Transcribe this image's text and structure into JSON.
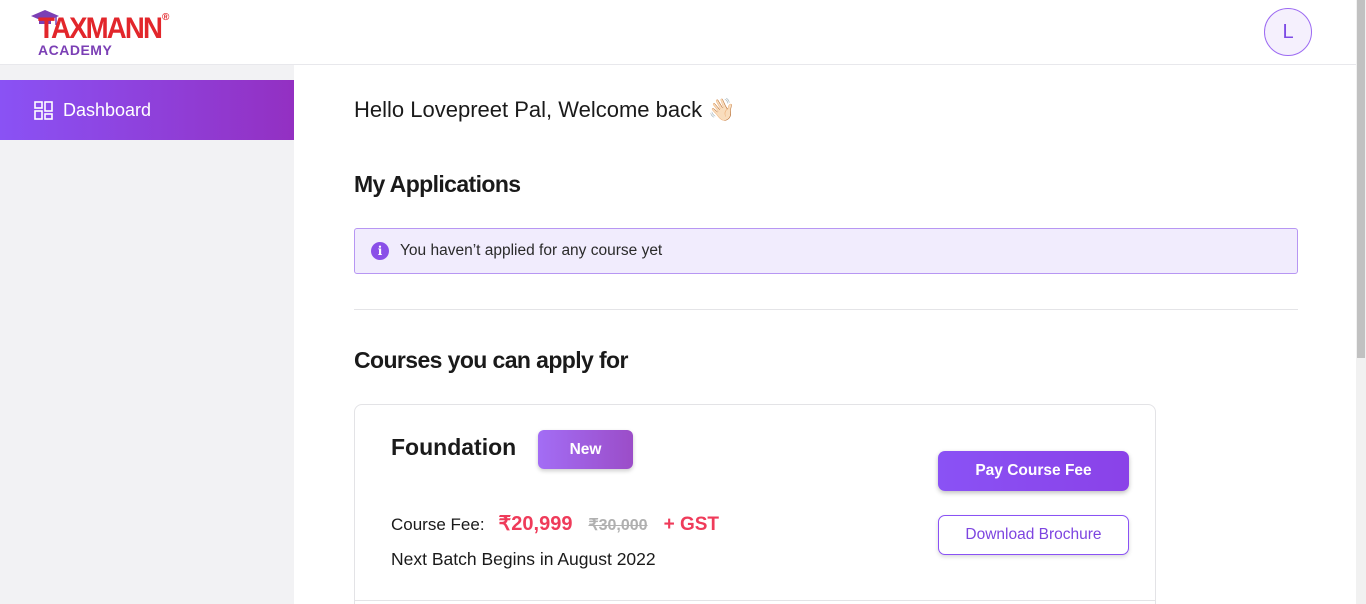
{
  "header": {
    "logo_brand": "TAXMANN",
    "logo_sub": "ACADEMY",
    "logo_reg": "®",
    "avatar_initial": "L"
  },
  "sidebar": {
    "items": [
      {
        "label": "Dashboard",
        "icon": "dashboard-icon",
        "active": true
      }
    ]
  },
  "main": {
    "greeting": "Hello Lovepreet Pal, Welcome back 👋🏻",
    "applications_title": "My Applications",
    "no_applications_message": "You haven’t applied for any course yet",
    "courses_title": "Courses you can apply for",
    "course": {
      "title": "Foundation",
      "badge": "New",
      "fee_label": "Course Fee:",
      "price": "₹20,999",
      "old_price": "₹30,000",
      "gst": "+ GST",
      "batch": "Next Batch Begins in August 2022",
      "pay_button": "Pay Course Fee",
      "brochure_button": "Download Brochure"
    }
  },
  "colors": {
    "accent": "#8a52f5",
    "price": "#ef3b5a",
    "brand_red": "#e2262b",
    "brand_purple": "#7b3fb5"
  }
}
